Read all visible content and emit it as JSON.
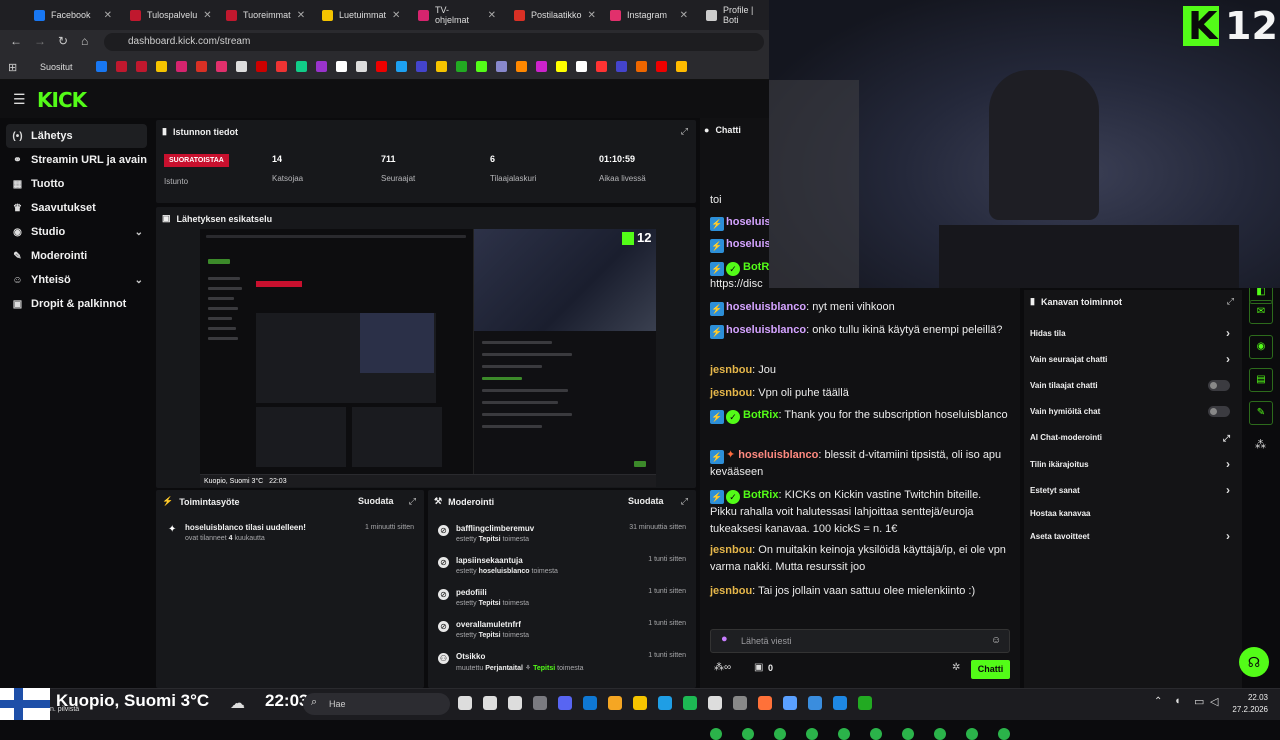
{
  "browser": {
    "tabs": [
      {
        "label": "Facebook",
        "color": "#1877f2"
      },
      {
        "label": "Tulospalvelu",
        "color": "#c0182e"
      },
      {
        "label": "Tuoreimmat",
        "color": "#c0182e"
      },
      {
        "label": "Luetuimmat",
        "color": "#f5c400"
      },
      {
        "label": "TV-ohjelmat",
        "color": "#d6246e"
      },
      {
        "label": "Postilaatikko",
        "color": "#d93025"
      },
      {
        "label": "Instagram",
        "color": "#e1306c"
      },
      {
        "label": "Profile | Boti",
        "color": "#cccccc"
      }
    ],
    "url": "dashboard.kick.com/stream",
    "bookmarks_label": "Suositut"
  },
  "kick": {
    "logo": "KICK",
    "sidebar": [
      {
        "label": "Lähetys",
        "icon": "broadcast-icon",
        "glyph": "(•)"
      },
      {
        "label": "Streamin URL ja avain",
        "icon": "link-icon",
        "glyph": "⚭"
      },
      {
        "label": "Tuotto",
        "icon": "revenue-icon",
        "glyph": "▦"
      },
      {
        "label": "Saavutukset",
        "icon": "trophy-icon",
        "glyph": "♛"
      },
      {
        "label": "Studio",
        "icon": "palette-icon",
        "glyph": "◉"
      },
      {
        "label": "Moderointi",
        "icon": "wrench-icon",
        "glyph": "✎"
      },
      {
        "label": "Yhteisö",
        "icon": "community-icon",
        "glyph": "☺"
      },
      {
        "label": "Dropit & palkinnot",
        "icon": "gift-icon",
        "glyph": "▣"
      }
    ],
    "session": {
      "title": "Istunnon tiedot",
      "badge": "SUORATOISTAA",
      "session_label": "Istunto",
      "stats": [
        {
          "value": "14",
          "label": "Katsojaa"
        },
        {
          "value": "711",
          "label": "Seuraajat"
        },
        {
          "value": "6",
          "label": "Tilaajalaskuri"
        },
        {
          "value": "01:10:59",
          "label": "Aikaa livessä"
        }
      ]
    },
    "preview": {
      "title": "Lähetyksen esikatselu",
      "weather_text": "Kuopio, Suomi 3°C",
      "time_text": "22:03"
    },
    "activity": {
      "title": "Toimintasyöte",
      "filter": "Suodata",
      "items": [
        {
          "name": "hoseluisblanco tilasi uudelleen!",
          "sub_prefix": "ovat tilanneet ",
          "sub_count": "4",
          "sub_suffix": " kuukautta",
          "time": "1 minuutti sitten"
        }
      ]
    },
    "moderation": {
      "title": "Moderointi",
      "filter": "Suodata",
      "items": [
        {
          "name": "bafflingclimberemuv",
          "action": "estetty",
          "by": "Tepitsi",
          "suffix": "toimesta",
          "time": "31 minuuttia sitten"
        },
        {
          "name": "lapsiinsekaantuja",
          "action": "estetty",
          "by": "hoseluisblanco",
          "suffix": "toimesta",
          "time": "1 tunti sitten"
        },
        {
          "name": "pedofiili",
          "action": "estetty",
          "by": "Tepitsi",
          "suffix": "toimesta",
          "time": "1 tunti sitten"
        },
        {
          "name": "overallamuletnfrf",
          "action": "estetty",
          "by": "Tepitsi",
          "suffix": "toimesta",
          "time": "1 tunti sitten"
        },
        {
          "name": "Otsikko",
          "action": "muutettu",
          "by": "Perjantaital",
          "suffix": "toimesta",
          "by2": "Tepitsi",
          "time": "1 tunti sitten"
        }
      ]
    },
    "chat": {
      "title": "Chatti",
      "messages": [
        {
          "user": "",
          "text": "toi"
        },
        {
          "user": "hoseluis",
          "text": ""
        },
        {
          "user": "hoseluis",
          "text": ""
        },
        {
          "user": "BotR",
          "text": ""
        },
        {
          "user": "",
          "text": "https://disc"
        },
        {
          "user": "hoseluisblanco",
          "text": "nyt meni vihkoon"
        },
        {
          "user": "hoseluisblanco",
          "text": "onko tullu ikinä käytyä enempi peleillä?"
        },
        {
          "user": "jesnbou",
          "text": "Jou"
        },
        {
          "user": "jesnbou",
          "text": "Vpn oli puhe täällä"
        },
        {
          "user": "BotRix",
          "text": "Thank you for the subscription hoseluisblanco"
        },
        {
          "user": "hoseluisblanco",
          "text": "blessit d-vitamiini tipsistä, oli iso apu kevääseen"
        },
        {
          "user": "BotRix",
          "text": "KICKs on Kickin vastine Twitchin biteille. Pikku rahalla voit halutessasi lahjoittaa senttejä/euroja tukeaksesi kanavaa. 100 kickS = n. 1€"
        },
        {
          "user": "jesnbou",
          "text": "On muitakin keinoja yksilöidä käyttäjä/ip, ei ole vpn varma nakki. Mutta resurssit joo"
        },
        {
          "user": "jesnbou",
          "text": "Tai jos jollain vaan sattuu olee mielenkiinto :)"
        }
      ],
      "input_placeholder": "Lähetä viesti",
      "points": "0",
      "send_label": "Chatti"
    },
    "channel_actions": {
      "title": "Kanavan toiminnot",
      "items": [
        {
          "label": "Hidas tila",
          "kind": "chevron"
        },
        {
          "label": "Vain seuraajat chatti",
          "kind": "chevron"
        },
        {
          "label": "Vain tilaajat chatti",
          "kind": "toggle"
        },
        {
          "label": "Vain hymiöitä chat",
          "kind": "toggle"
        },
        {
          "label": "AI Chat-moderointi",
          "kind": "external"
        },
        {
          "label": "Tilin ikärajoitus",
          "kind": "chevron"
        },
        {
          "label": "Estetyt sanat",
          "kind": "chevron"
        },
        {
          "label": "Hostaa kanavaa",
          "kind": "none"
        },
        {
          "label": "Aseta tavoitteet",
          "kind": "chevron"
        }
      ]
    }
  },
  "webcam": {
    "logo": "K",
    "number": "12"
  },
  "taskbar": {
    "weather": "Kuopio, Suomi 3°C",
    "weather_sub": "n. pilvistä",
    "time": "22:03",
    "search": "Hae",
    "clock_time": "22.03",
    "clock_date": "27.2.2026"
  },
  "colors": {
    "accent": "#53fc18",
    "live": "#c8102e"
  }
}
